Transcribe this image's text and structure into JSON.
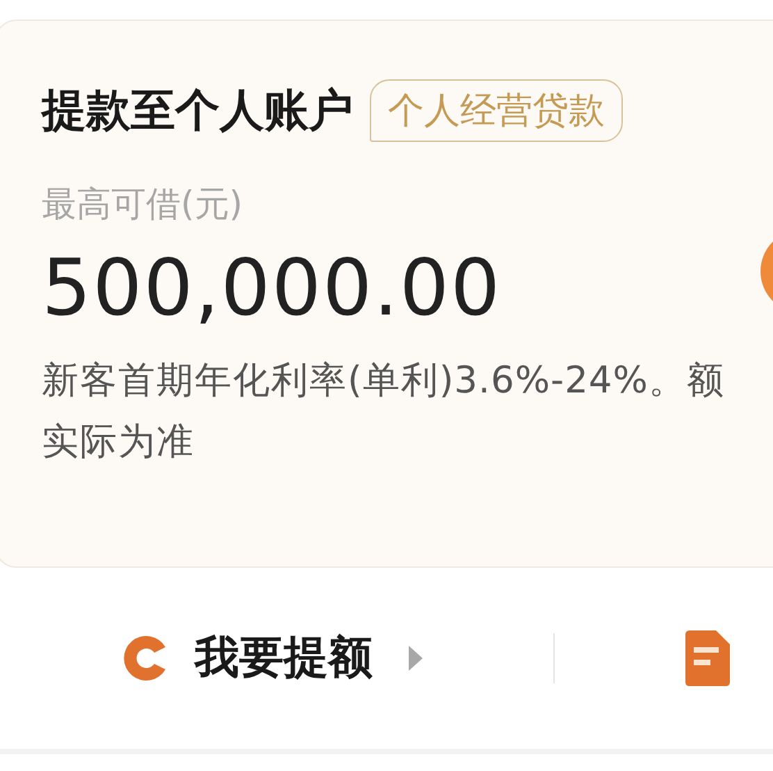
{
  "card": {
    "title": "提款至个人账户",
    "tag": "个人经营贷款",
    "amount_label": "最高可借(元)",
    "amount": "500,000.00",
    "note_lines": [
      "新客首期年化利率(单利)3.6%-24%。额",
      "实际为准"
    ]
  },
  "actions": [
    {
      "kind": "raise",
      "label": "我要提额"
    },
    {
      "kind": "document"
    }
  ]
}
